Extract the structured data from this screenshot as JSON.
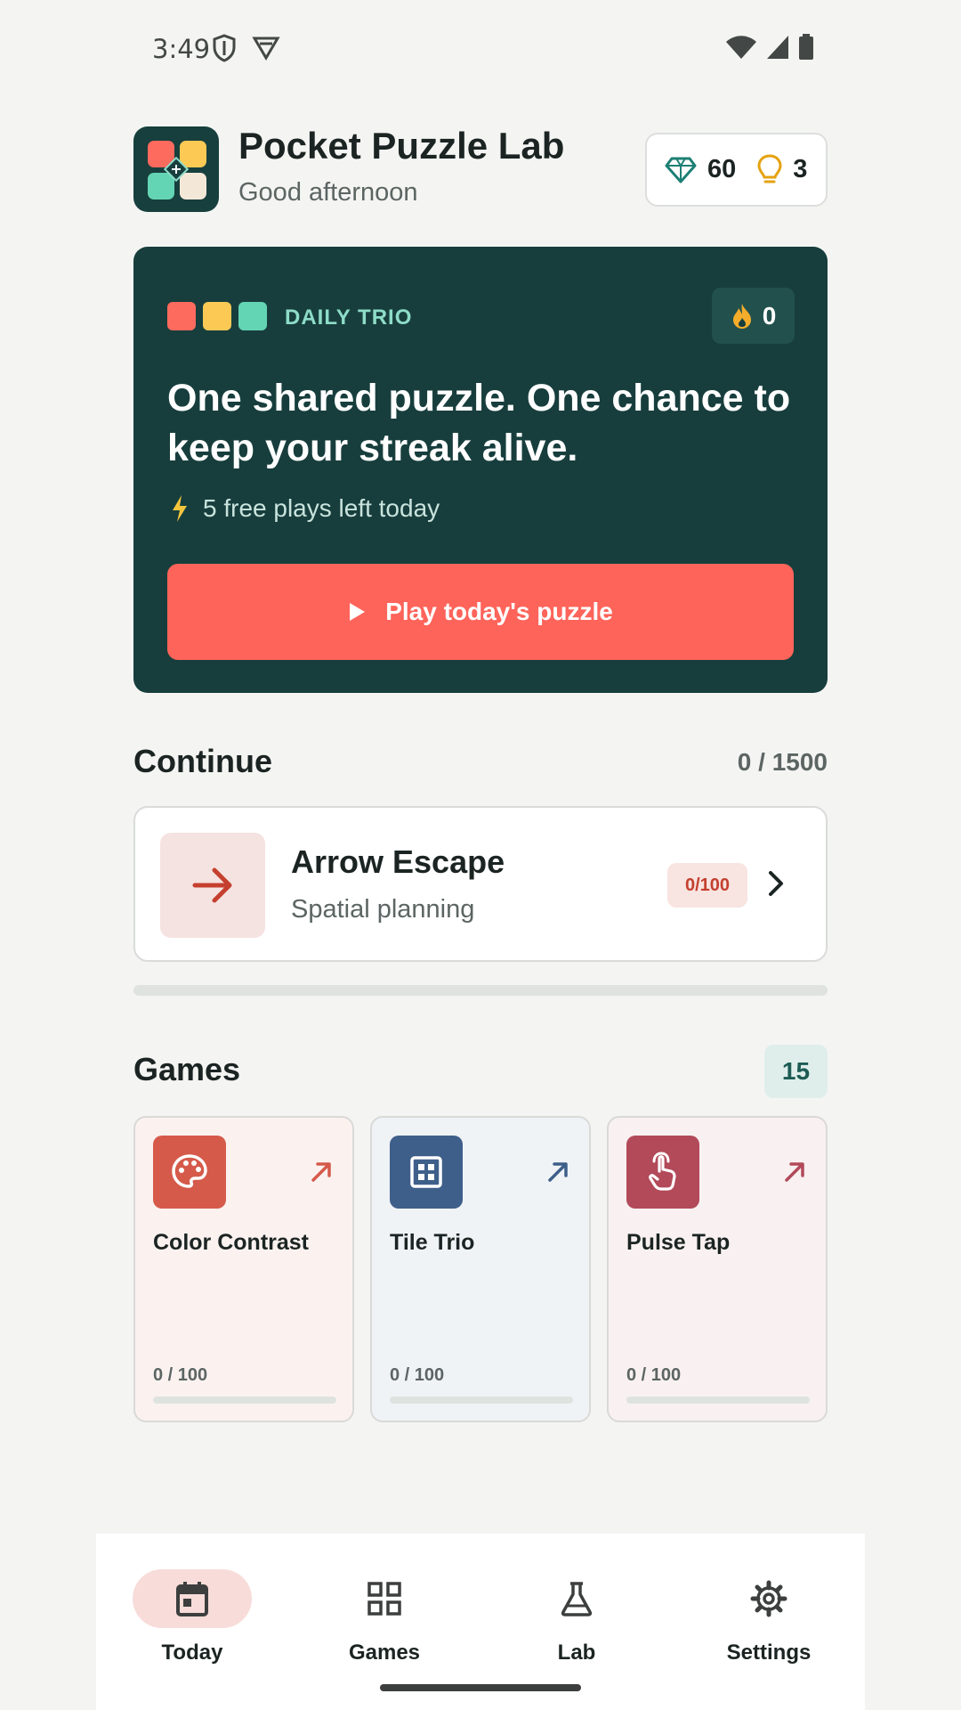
{
  "status_bar": {
    "time": "3:49",
    "icons": [
      "shield-icon",
      "vpn-icon",
      "wifi-icon",
      "signal-icon",
      "battery-icon"
    ]
  },
  "header": {
    "title": "Pocket Puzzle Lab",
    "greeting": "Good afternoon",
    "gems": "60",
    "hints": "3",
    "icons": [
      "gem-icon",
      "lightbulb-icon"
    ]
  },
  "daily": {
    "label": "DAILY TRIO",
    "streak": "0",
    "headline": "One shared puzzle. One chance to keep your streak alive.",
    "plays_left": "5 free plays left today",
    "play_button": "Play today's puzzle",
    "square_colors": [
      "#fd6a5e",
      "#fdc955",
      "#64d5b4"
    ]
  },
  "continue": {
    "title": "Continue",
    "total": "0 / 1500",
    "total_progress": 0,
    "game": {
      "name": "Arrow Escape",
      "category": "Spatial planning",
      "badge": "0/100"
    }
  },
  "games": {
    "title": "Games",
    "count": "15",
    "items": [
      {
        "name": "Color Contrast",
        "progress": "0 / 100",
        "progress_fraction": 0,
        "icon": "palette-icon",
        "accent": "#d55a4a",
        "bg": "#fbf2f0"
      },
      {
        "name": "Tile Trio",
        "progress": "0 / 100",
        "progress_fraction": 0,
        "icon": "grid-tile-icon",
        "accent": "#3e5f8a",
        "bg": "#f0f3f6"
      },
      {
        "name": "Pulse Tap",
        "progress": "0 / 100",
        "progress_fraction": 0,
        "icon": "tap-icon",
        "accent": "#b24a5a",
        "bg": "#f9f1f1"
      }
    ]
  },
  "nav": {
    "items": [
      {
        "label": "Today",
        "icon": "calendar-icon",
        "active": true
      },
      {
        "label": "Games",
        "icon": "grid-icon",
        "active": false
      },
      {
        "label": "Lab",
        "icon": "flask-icon",
        "active": false
      },
      {
        "label": "Settings",
        "icon": "gear-icon",
        "active": false
      }
    ]
  },
  "colors": {
    "brand_dark": "#173e3d",
    "accent_coral": "#fe645a",
    "background": "#f4f5f3"
  }
}
